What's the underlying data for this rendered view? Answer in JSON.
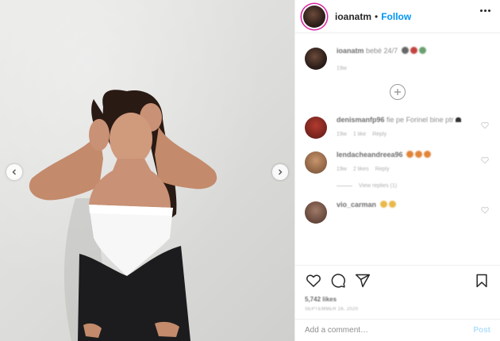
{
  "post": {
    "photo_alt": "",
    "nav_prev_icon": "chevron-left-icon",
    "nav_next_icon": "chevron-right-icon"
  },
  "header": {
    "username": "ioanatm",
    "separator": "•",
    "follow_label": "Follow",
    "more_icon": "more-horizontal-icon"
  },
  "caption": {
    "username": "ioanatm",
    "text": "bebé 24/7",
    "time": "19w"
  },
  "load_more_icon": "plus-circle-icon",
  "comments": [
    {
      "username": "denismanfp96",
      "text": "fie pe Forinel bine ptr",
      "time": "19w",
      "likes": "1 like",
      "reply": "Reply"
    },
    {
      "username": "lendacheandreea96",
      "text": "",
      "time": "19w",
      "likes": "2 likes",
      "reply": "Reply",
      "view_replies": "View replies (1)"
    },
    {
      "username": "vio_carman",
      "text": "",
      "time": "",
      "likes": "",
      "reply": ""
    }
  ],
  "actions": {
    "like_icon": "heart-icon",
    "comment_icon": "comment-icon",
    "share_icon": "share-icon",
    "save_icon": "bookmark-icon",
    "likes": "5,742 likes",
    "date": "SEPTEMBER 16, 2020"
  },
  "add_comment": {
    "placeholder": "Add a comment…",
    "post_label": "Post"
  },
  "colors": {
    "accent": "#0095f6",
    "post_disabled": "#b2dffc",
    "story_ring": "#d6249f"
  }
}
